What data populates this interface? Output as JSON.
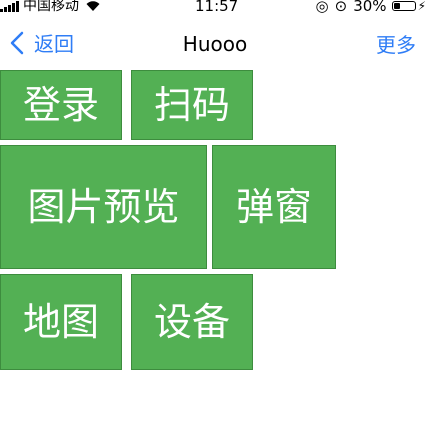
{
  "status_bar": {
    "carrier": "中国移动",
    "time": "11:57",
    "battery_percent": "30%",
    "battery_level": 0.3
  },
  "nav": {
    "back_label": "返回",
    "title": "Huooo",
    "more_label": "更多"
  },
  "tiles": [
    {
      "label": "登录"
    },
    {
      "label": "扫码"
    },
    {
      "label": "图片预览"
    },
    {
      "label": "弹窗"
    },
    {
      "label": "地图"
    },
    {
      "label": "设备"
    }
  ],
  "colors": {
    "accent": "#2f7df6",
    "tile": "#53b054"
  }
}
